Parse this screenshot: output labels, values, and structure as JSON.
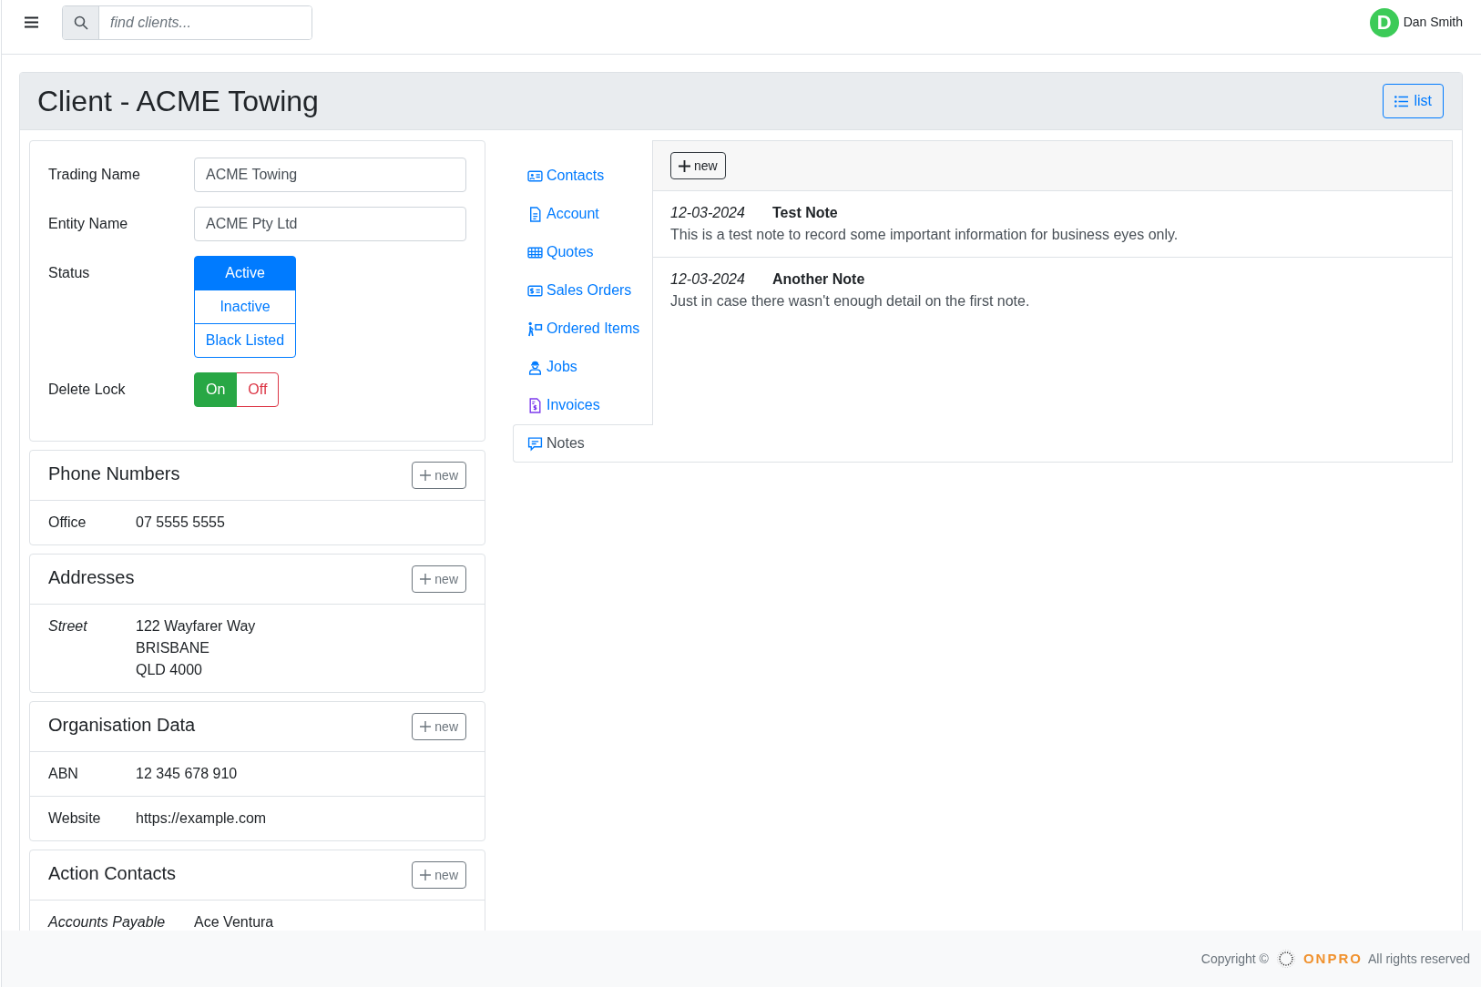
{
  "topbar": {
    "search": {
      "placeholder": "find clients..."
    },
    "user": {
      "initial": "D",
      "name": "Dan Smith"
    }
  },
  "header": {
    "title": "Client - ACME Towing",
    "list_button": "list"
  },
  "form": {
    "fields": [
      {
        "kind": "text",
        "label": "Trading Name",
        "value": "ACME Towing"
      },
      {
        "kind": "text",
        "label": "Entity Name",
        "value": "ACME Pty Ltd"
      },
      {
        "kind": "choice",
        "label": "Status",
        "options": [
          {
            "label": "Active",
            "selected": true
          },
          {
            "label": "Inactive",
            "selected": false
          },
          {
            "label": "Black Listed",
            "selected": false
          }
        ]
      },
      {
        "kind": "toggle",
        "label": "Delete Lock",
        "options": [
          {
            "label": "On",
            "selected": true,
            "color": "#28a745"
          },
          {
            "label": "Off",
            "selected": false,
            "color": "#dc3545"
          }
        ]
      }
    ]
  },
  "sections": [
    {
      "title": "Phone Numbers",
      "new_button": "new",
      "rows": [
        {
          "kind": "field",
          "label": "Office",
          "values": [
            "07 5555 5555"
          ]
        }
      ]
    },
    {
      "title": "Addresses",
      "new_button": "new",
      "rows": [
        {
          "kind": "role",
          "label": "Street",
          "values": [
            "122 Wayfarer Way",
            "BRISBANE",
            "QLD 4000"
          ]
        }
      ]
    },
    {
      "title": "Organisation Data",
      "new_button": "new",
      "rows": [
        {
          "kind": "field",
          "label": "ABN",
          "values": [
            "12 345 678 910"
          ]
        },
        {
          "kind": "field",
          "label": "Website",
          "values": [
            "https://example.com"
          ]
        }
      ]
    },
    {
      "title": "Action Contacts",
      "new_button": "new",
      "rows": [
        {
          "kind": "role",
          "label": "Accounts Payable",
          "values": [
            "Ace Ventura"
          ]
        }
      ]
    }
  ],
  "tabs": [
    {
      "label": "Contacts",
      "selected": false
    },
    {
      "label": "Account",
      "selected": false
    },
    {
      "label": "Quotes",
      "selected": false
    },
    {
      "label": "Sales Orders",
      "selected": false
    },
    {
      "label": "Ordered Items",
      "selected": false
    },
    {
      "label": "Jobs",
      "selected": false
    },
    {
      "label": "Invoices",
      "selected": false
    },
    {
      "label": "Notes",
      "selected": true
    }
  ],
  "notes_panel": {
    "new_button": "new",
    "notes": [
      {
        "date": "12-03-2024",
        "title": "Test Note",
        "body": "This is a test note to record some important information for business eyes only."
      },
      {
        "date": "12-03-2024",
        "title": "Another Note",
        "body": "Just in case there wasn't enough detail on the first note."
      }
    ]
  },
  "footer": {
    "copyright": "Copyright ©",
    "brand": "ONPRO",
    "rights": "All rights reserved"
  }
}
